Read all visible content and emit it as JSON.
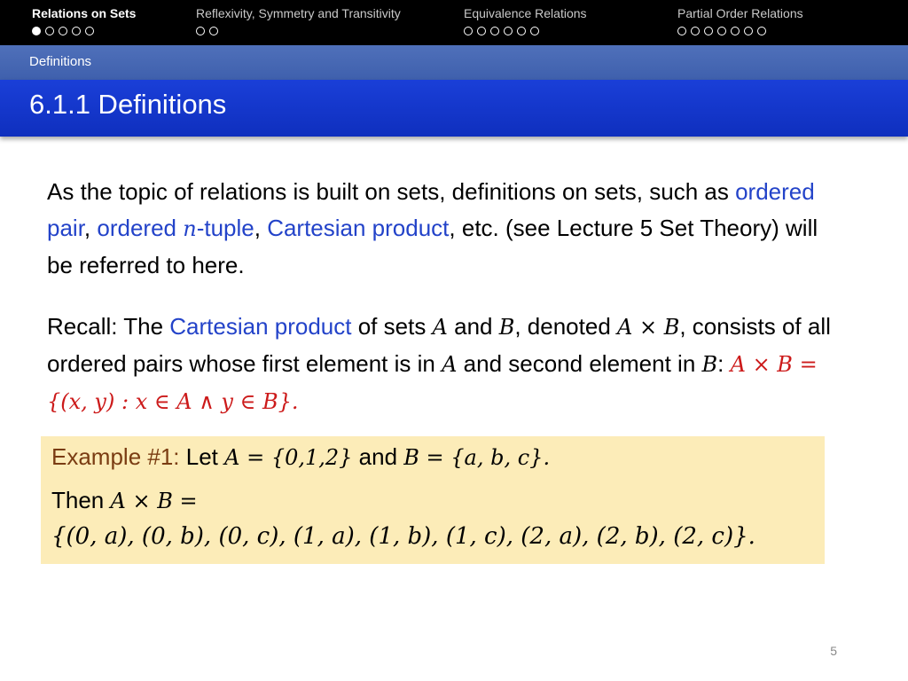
{
  "nav": {
    "sections": [
      {
        "label": "Relations on Sets",
        "dots": 5,
        "filled": 1,
        "active": true
      },
      {
        "label": "Reflexivity, Symmetry and Transitivity",
        "dots": 2,
        "filled": 0,
        "active": false
      },
      {
        "label": "Equivalence Relations",
        "dots": 6,
        "filled": 0,
        "active": false
      },
      {
        "label": "Partial Order Relations",
        "dots": 7,
        "filled": 0,
        "active": false
      }
    ]
  },
  "subsection": "Definitions",
  "title": "6.1.1 Definitions",
  "para1": {
    "t1": "As the topic of relations is built on sets, definitions on sets, such as ",
    "term1": "ordered pair",
    "t2": ", ",
    "term2a": "ordered ",
    "term2n": "n",
    "term2b": "-tuple",
    "t3": ", ",
    "term3": "Cartesian product",
    "t4": ", etc. (see Lecture 5 Set Theory) will be referred to here."
  },
  "para2": {
    "t1": "Recall: The ",
    "term": "Cartesian product",
    "t2": " of sets ",
    "a1": "A",
    "t3": " and ",
    "b1": "B",
    "t4": ", denoted ",
    "prod": "A × B",
    "t5": ", consists of all ordered pairs whose first element is in ",
    "a2": "A",
    "t6": " and second element in ",
    "b2": "B",
    "t7": ": ",
    "formula": "A × B = {(x, y) : x ∈ A ∧ y ∈ B}."
  },
  "example": {
    "heading": "Example #1:",
    "let": " Let ",
    "setA": "A = {0,1,2}",
    "and": " and ",
    "setB": "B = {a, b, c}.",
    "then": "Then ",
    "prod": "A × B =",
    "result": "{(0, a), (0, b), (0, c), (1, a), (1, b), (1, c), (2, a), (2, b), (2, c)}."
  },
  "page_number": "5"
}
